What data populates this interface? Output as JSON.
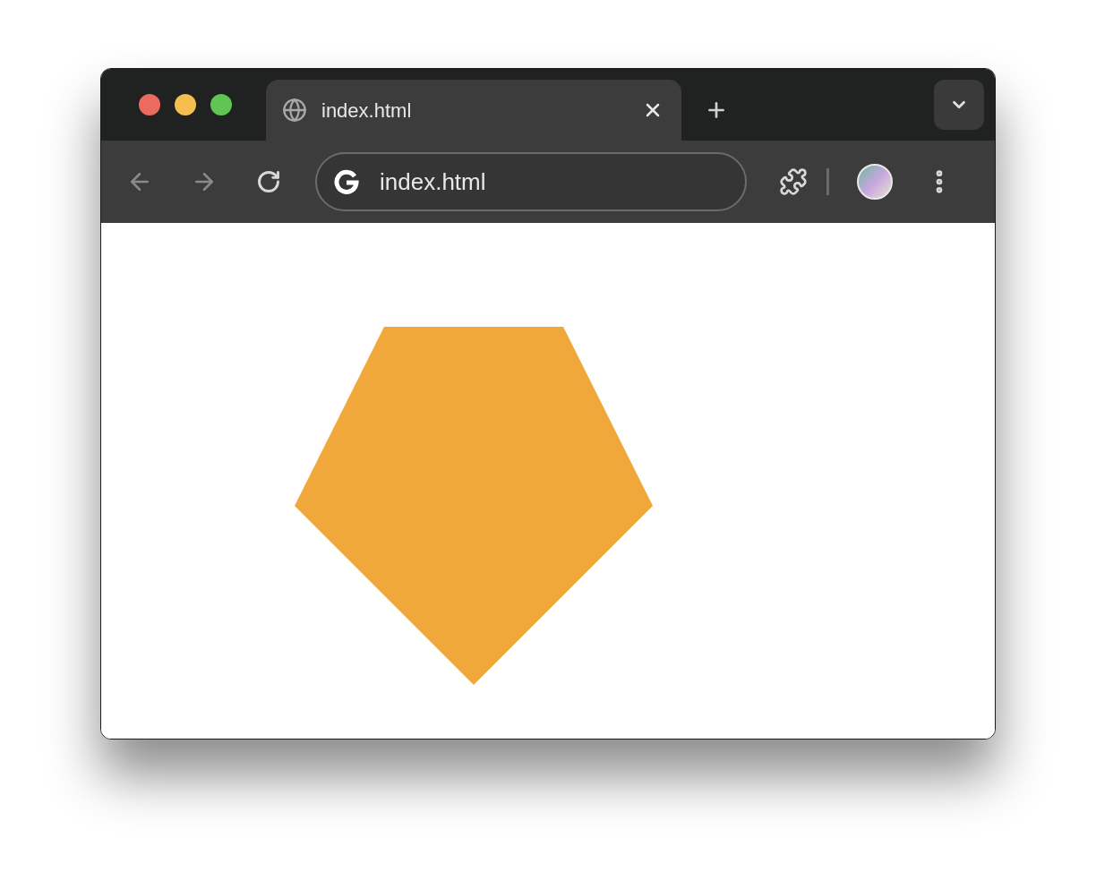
{
  "tabs": [
    {
      "title": "index.html",
      "selected": true
    }
  ],
  "address_bar": {
    "value": "index.html"
  }
}
